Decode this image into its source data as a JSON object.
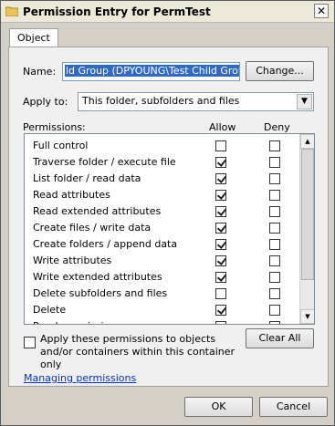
{
  "window": {
    "title": "Permission Entry for PermTest",
    "close_glyph": "✕"
  },
  "tabs": [
    {
      "label": "Object"
    }
  ],
  "name": {
    "label": "Name:",
    "value": "ld Group (DPYOUNG\\Test Child Group)",
    "change_button": "Change..."
  },
  "apply_to": {
    "label": "Apply to:",
    "value": "This folder, subfolders and files",
    "arrow_glyph": "▼"
  },
  "permissions": {
    "header": "Permissions:",
    "allow_header": "Allow",
    "deny_header": "Deny",
    "rows": [
      {
        "label": "Full control",
        "allow": false,
        "deny": false
      },
      {
        "label": "Traverse folder / execute file",
        "allow": true,
        "deny": false
      },
      {
        "label": "List folder / read data",
        "allow": true,
        "deny": false
      },
      {
        "label": "Read attributes",
        "allow": true,
        "deny": false
      },
      {
        "label": "Read extended attributes",
        "allow": true,
        "deny": false
      },
      {
        "label": "Create files / write data",
        "allow": true,
        "deny": false
      },
      {
        "label": "Create folders / append data",
        "allow": true,
        "deny": false
      },
      {
        "label": "Write attributes",
        "allow": true,
        "deny": false
      },
      {
        "label": "Write extended attributes",
        "allow": true,
        "deny": false
      },
      {
        "label": "Delete subfolders and files",
        "allow": false,
        "deny": false
      },
      {
        "label": "Delete",
        "allow": true,
        "deny": false
      },
      {
        "label": "Read permissions",
        "allow": true,
        "deny": false
      }
    ],
    "scroll_up_glyph": "▲",
    "scroll_down_glyph": "▼"
  },
  "apply_children": {
    "label": "Apply these permissions to objects and/or containers within this container only",
    "checked": false
  },
  "clear_all_button": "Clear All",
  "help_link": "Managing permissions",
  "footer": {
    "ok": "OK",
    "cancel": "Cancel"
  },
  "colors": {
    "selection": "#3169c6",
    "link": "#0033cc"
  },
  "icons": {
    "title": "folder-icon",
    "check": "checkmark-icon"
  }
}
